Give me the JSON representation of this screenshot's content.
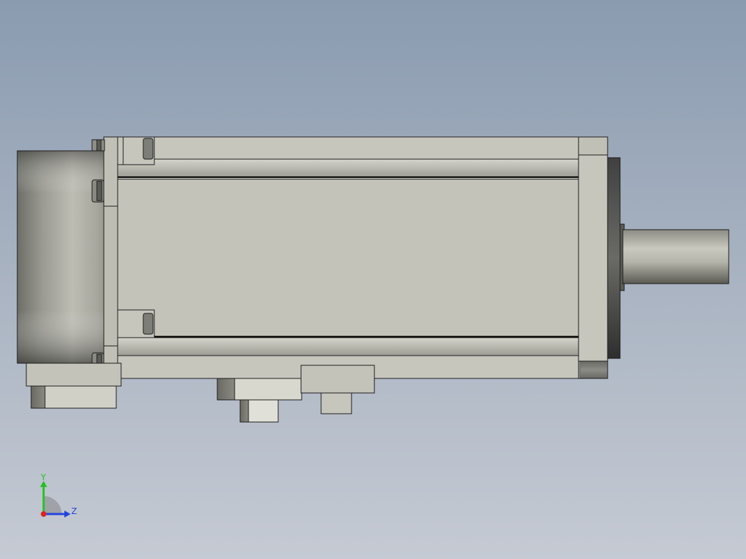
{
  "viewport": {
    "background_top": "#8a9bb0",
    "background_bottom": "#c5cad3"
  },
  "model": {
    "body_color": "#c3c3ba",
    "edge_color": "#1a1a1a",
    "shaft_color": "#b7b7ad",
    "shade_color": "#55554f"
  },
  "triad": {
    "y_label": "Y",
    "z_label": "Z",
    "y_color": "#22c222",
    "z_color": "#2244dd",
    "x_color": "#dd2222"
  }
}
